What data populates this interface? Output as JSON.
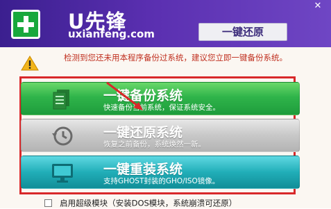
{
  "app": {
    "name": "U先锋",
    "url": "uxianfeng.com",
    "restore_tab": "一键还原",
    "close_glyph": "✕"
  },
  "warning": {
    "text": "检测到您还未用本程序备份过系统，建议您立即一键备份系统。"
  },
  "options": [
    {
      "title": "一键备份系统",
      "desc": "快速备份当前系统，保证系统安全。"
    },
    {
      "title": "一键还原系统",
      "desc": "恢复之前备份，系统焕然一新。"
    },
    {
      "title": "一键重装系统",
      "desc": "支持GHOST封装的GHO/ISO镜像。"
    }
  ],
  "bottom": {
    "checkbox_label": "启用超级模块（安装DOS模块，系统崩溃可还原）",
    "checked": false
  },
  "colors": {
    "titlebar": "#4b28a0",
    "backup": "#2fb44a",
    "restore": "#c8c8c8",
    "reinstall": "#21aeb8",
    "highlight_border": "#d8282a",
    "warning_text": "#c03020"
  },
  "icons": [
    "plus-logo-icon",
    "warning-icon",
    "document-icon",
    "history-icon",
    "monitor-icon"
  ]
}
